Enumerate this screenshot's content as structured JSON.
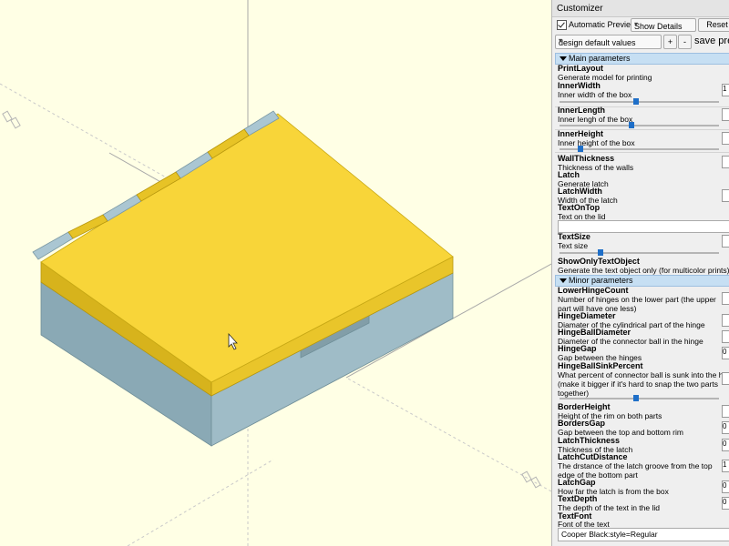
{
  "panel": {
    "title": "Customizer",
    "auto_preview_label": "Automatic Preview",
    "auto_preview_checked": true,
    "details_select": "Show Details",
    "reset_label": "Reset",
    "preset_select": "design default values",
    "add_label": "+",
    "remove_label": "-",
    "save_label": "save pre"
  },
  "sections": {
    "main": "Main parameters",
    "minor": "Minor parameters"
  },
  "params": {
    "print_layout": {
      "name": "PrintLayout",
      "desc": "Generate model for printing"
    },
    "inner_width": {
      "name": "InnerWidth",
      "desc": "Inner width of the box",
      "field": "1"
    },
    "inner_length": {
      "name": "InnerLength",
      "desc": "Inner lengh of the box"
    },
    "inner_height": {
      "name": "InnerHeight",
      "desc": "Inner height of the box"
    },
    "wall_thickness": {
      "name": "WallThickness",
      "desc": "Thickness of the walls"
    },
    "latch": {
      "name": "Latch",
      "desc": "Generate latch"
    },
    "latch_width": {
      "name": "LatchWidth",
      "desc": "Width of the latch"
    },
    "text_on_top": {
      "name": "TextOnTop",
      "desc": "Text on the lid"
    },
    "text_size": {
      "name": "TextSize",
      "desc": "Text size"
    },
    "show_only_text": {
      "name": "ShowOnlyTextObject",
      "desc": "Generate the text object only (for multicolor prints)"
    },
    "lower_hinge_count": {
      "name": "LowerHingeCount",
      "desc1": "Number of hinges on the lower part (the upper",
      "desc2": "part will have one less)"
    },
    "hinge_diameter": {
      "name": "HingeDiameter",
      "desc": "Diamater of the cylindrical part of the hinge"
    },
    "hinge_ball_diameter": {
      "name": "HingeBallDiameter",
      "desc": "Diameter of the connector ball in the hinge"
    },
    "hinge_gap": {
      "name": "HingeGap",
      "desc": "Gap between the hinges",
      "field": "0"
    },
    "hinge_ball_sink": {
      "name": "HingeBallSinkPercent",
      "desc1": "What percent of connector ball is sunk into the hinge",
      "desc2": "(make it bigger if it's hard to snap the two parts",
      "desc3": "together)"
    },
    "border_height": {
      "name": "BorderHeight",
      "desc": "Height of the rim on both parts"
    },
    "borders_gap": {
      "name": "BordersGap",
      "desc": "Gap between the top and bottom rim",
      "field": "0"
    },
    "latch_thickness": {
      "name": "LatchThickness",
      "desc": "Thickness of the latch",
      "field": "0"
    },
    "latch_cut_distance": {
      "name": "LatchCutDistance",
      "desc1": "The drstance of the latch groove from the top",
      "desc2": "edge of the bottom part",
      "field": "1"
    },
    "latch_gap": {
      "name": "LatchGap",
      "desc": "How far the latch is from the box",
      "field": "0"
    },
    "text_depth": {
      "name": "TextDepth",
      "desc": "The depth of the text in the lid",
      "field": "0"
    },
    "text_font": {
      "name": "TextFont",
      "desc": "Font of the text",
      "value": "Cooper Black:style=Regular"
    }
  },
  "sliders": {
    "inner_width": 0.48,
    "inner_length": 0.45,
    "inner_height": 0.12,
    "text_size": 0.25,
    "hinge_ball_sink": 0.48
  },
  "colors": {
    "viewport_bg": "#ffffe5",
    "lid": "#f8d539",
    "lid_dark": "#dab81d",
    "base": "#94b4c0",
    "base_dark": "#7e9ea8",
    "section_bg": "#c6dff3",
    "slider_thumb": "#1f6fc8"
  }
}
